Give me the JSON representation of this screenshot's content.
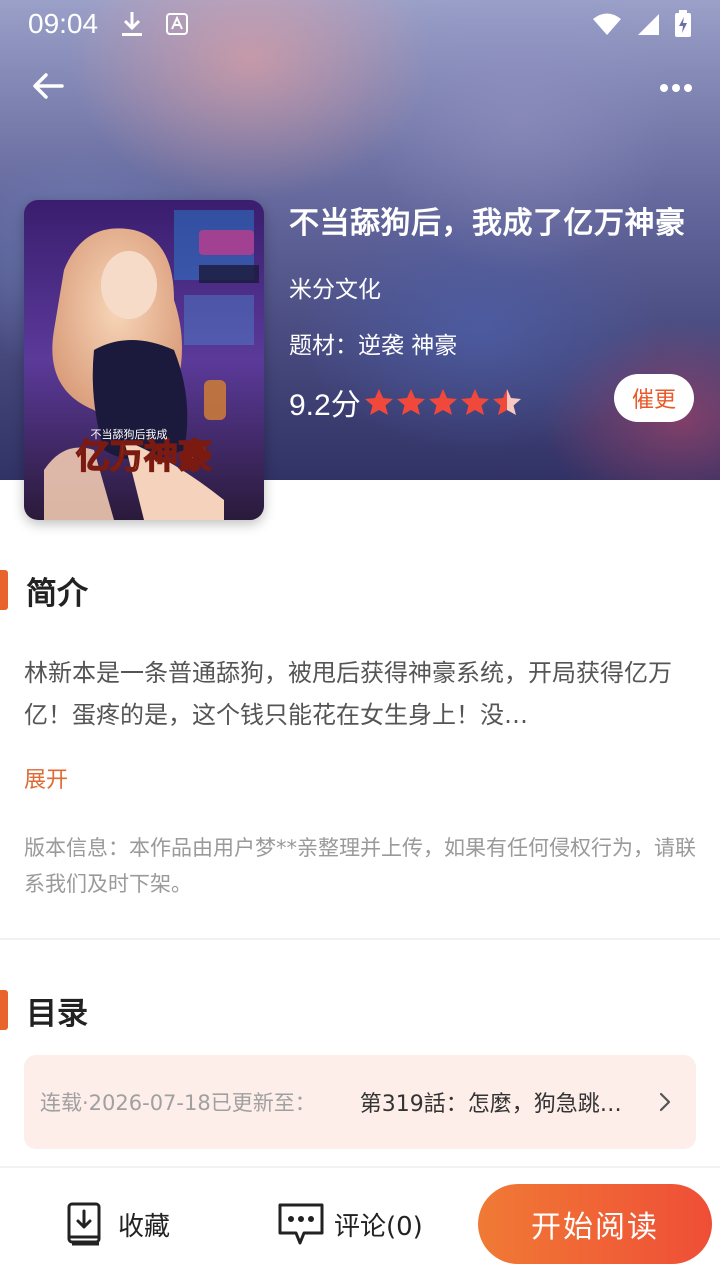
{
  "status_bar": {
    "time": "09:04"
  },
  "book": {
    "title": "不当舔狗后，我成了亿万神豪",
    "author": "米分文化",
    "genre_label": "题材：",
    "genres": "逆袭 神豪",
    "score": "9.2分",
    "stars": 4.5,
    "cover_text": "亿万神豪",
    "cover_subtext": "不当舔狗后我成"
  },
  "urge_button": "催更",
  "synopsis": {
    "title": "简介",
    "text": "林新本是一条普通舔狗，被甩后获得神豪系统，开局获得亿万亿！蛋疼的是，这个钱只能花在女生身上！没…",
    "expand": "展开",
    "version_info": "版本信息：本作品由用户梦**亲整理并上传，如果有任何侵权行为，请联系我们及时下架。"
  },
  "catalog": {
    "title": "目录",
    "status": "连载·2026-07-18已更新至：",
    "latest": "第319話：怎麼，狗急跳…"
  },
  "bottom_bar": {
    "favorite": "收藏",
    "comment": "评论(0)",
    "read": "开始阅读"
  },
  "colors": {
    "accent": "#e8642c",
    "read_button": "#ef5a35",
    "catalog_bg": "#fdeee9"
  }
}
